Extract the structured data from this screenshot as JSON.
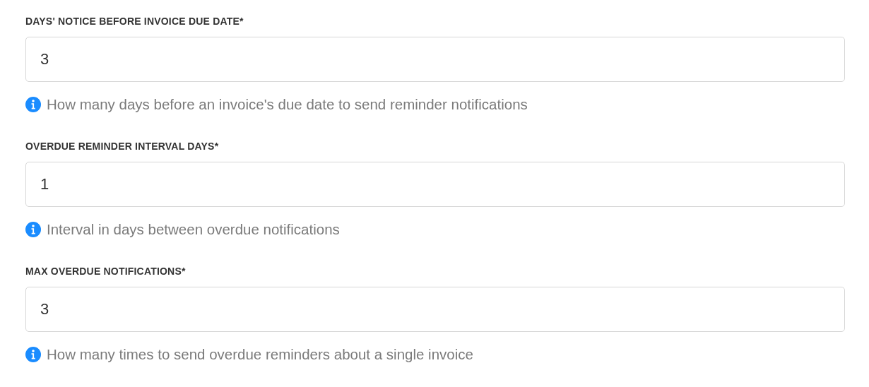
{
  "fields": [
    {
      "label": "DAYS' NOTICE BEFORE INVOICE DUE DATE*",
      "value": "3",
      "hint": "How many days before an invoice's due date to send reminder notifications"
    },
    {
      "label": "OVERDUE REMINDER INTERVAL DAYS*",
      "value": "1",
      "hint": "Interval in days between overdue notifications"
    },
    {
      "label": "MAX OVERDUE NOTIFICATIONS*",
      "value": "3",
      "hint": "How many times to send overdue reminders about a single invoice"
    }
  ]
}
